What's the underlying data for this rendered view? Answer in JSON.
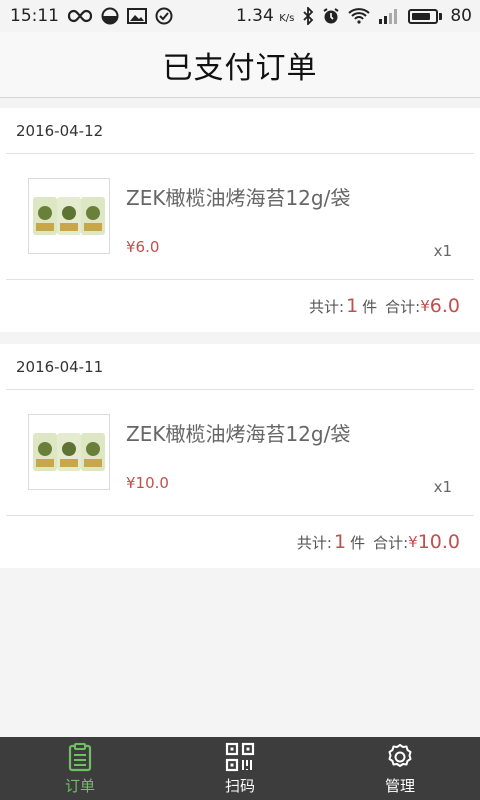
{
  "status_bar": {
    "time": "15:11",
    "speed": "1.34",
    "speed_unit": "K/s",
    "battery": "80"
  },
  "header": {
    "title": "已支付订单"
  },
  "orders": [
    {
      "date": "2016-04-12",
      "item": {
        "name": "ZEK橄榄油烤海苔12g/袋",
        "price": "¥6.0",
        "qty": "x1"
      },
      "summary": {
        "count_label": "共计:",
        "count": "1",
        "count_unit": "件",
        "total_label": "合计:",
        "currency": "¥",
        "total": "6.0"
      }
    },
    {
      "date": "2016-04-11",
      "item": {
        "name": "ZEK橄榄油烤海苔12g/袋",
        "price": "¥10.0",
        "qty": "x1"
      },
      "summary": {
        "count_label": "共计:",
        "count": "1",
        "count_unit": "件",
        "total_label": "合计:",
        "currency": "¥",
        "total": "10.0"
      }
    }
  ],
  "nav": {
    "items": [
      {
        "label": "订单",
        "icon": "clipboard-icon",
        "active": true
      },
      {
        "label": "扫码",
        "icon": "qr-code-icon",
        "active": false
      },
      {
        "label": "管理",
        "icon": "gear-icon",
        "active": false
      }
    ]
  },
  "colors": {
    "accent": "#6fbf63",
    "price": "#c0504d",
    "nav_bg": "#3d3d3d"
  }
}
